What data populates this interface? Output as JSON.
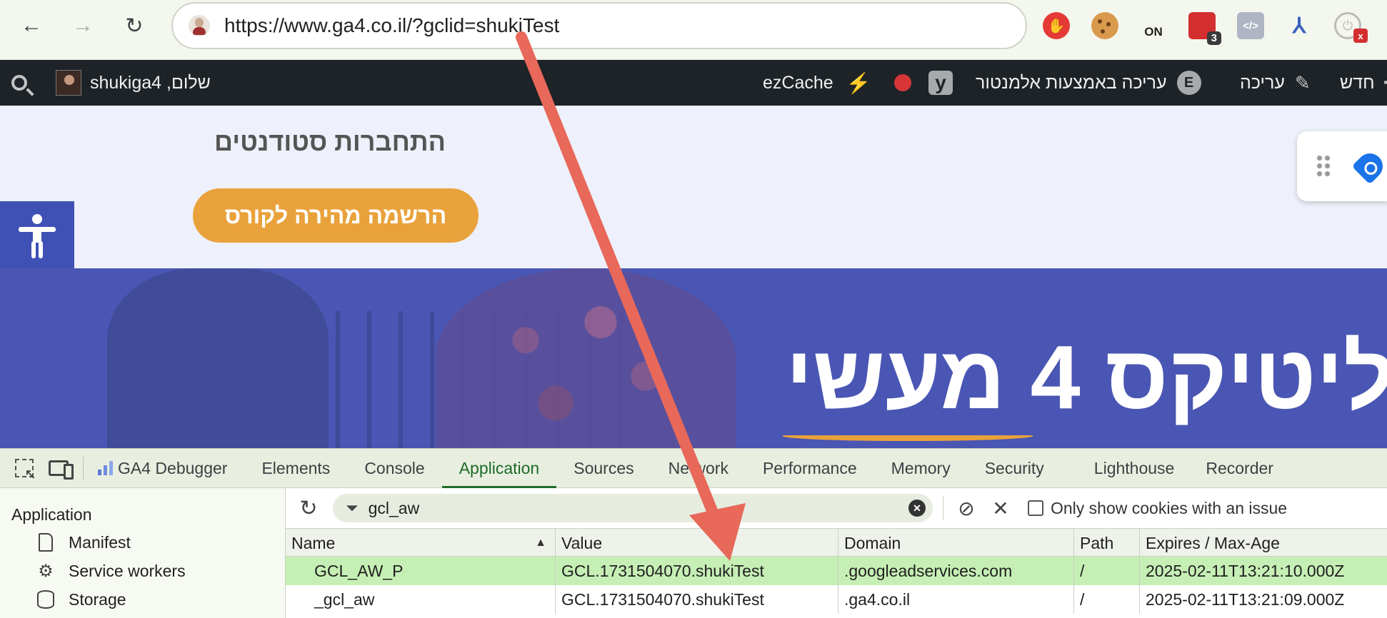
{
  "browser": {
    "url": "https://www.ga4.co.il/?gclid=shukiTest",
    "extensions": {
      "on_label": "ON",
      "red_badge": "3",
      "code_label": "</>",
      "x_badge": "x"
    }
  },
  "wpbar": {
    "greeting": "שלום, shukiga4",
    "ezcache": "ezCache",
    "elementor_edit": "עריכה באמצעות אלמנטור",
    "edit": "עריכה",
    "new": "חדש",
    "y_letter": "y",
    "e_letter": "E"
  },
  "page": {
    "connect_link": "התחברות סטודנטים",
    "cta_label": "הרשמה מהירה לקורס",
    "hero_title": "ליטיקס 4 מעשי"
  },
  "devtools": {
    "tabs": [
      {
        "label": "GA4 Debugger"
      },
      {
        "label": "Elements"
      },
      {
        "label": "Console"
      },
      {
        "label": "Application"
      },
      {
        "label": "Sources"
      },
      {
        "label": "Network"
      },
      {
        "label": "Performance"
      },
      {
        "label": "Memory"
      },
      {
        "label": "Security"
      },
      {
        "label": "Lighthouse"
      },
      {
        "label": "Recorder"
      }
    ],
    "active_tab": "Application",
    "sidebar": {
      "heading": "Application",
      "items": [
        {
          "label": "Manifest"
        },
        {
          "label": "Service workers"
        },
        {
          "label": "Storage"
        }
      ]
    },
    "filter": {
      "value": "gcl_aw",
      "only_issues_label": "Only show cookies with an issue"
    },
    "table": {
      "columns": [
        "Name",
        "Value",
        "Domain",
        "Path",
        "Expires / Max-Age"
      ],
      "rows": [
        {
          "name": "GCL_AW_P",
          "value": "GCL.1731504070.shukiTest",
          "domain": ".googleadservices.com",
          "path": "/",
          "expires": "2025-02-11T13:21:10.000Z",
          "selected": true
        },
        {
          "name": "_gcl_aw",
          "value": "GCL.1731504070.shukiTest",
          "domain": ".ga4.co.il",
          "path": "/",
          "expires": "2025-02-11T13:21:09.000Z",
          "selected": false
        }
      ]
    }
  },
  "colors": {
    "annotation_arrow": "#e8685a",
    "accent_green": "#1e6b28",
    "selected_row": "#c6efb5",
    "cta": "#e9a23b",
    "hero": "#4a56b3"
  }
}
